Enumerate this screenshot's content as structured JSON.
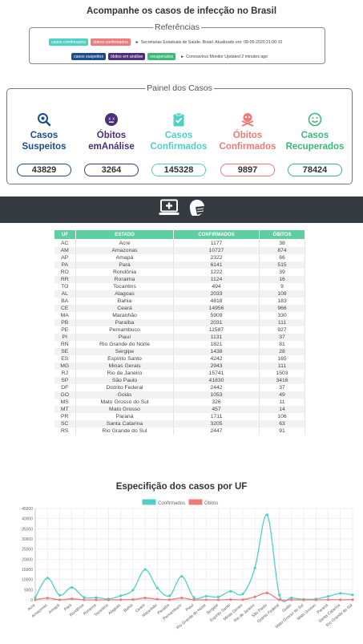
{
  "page": {
    "title": "Acompanhe os casos de infecção no Brasil"
  },
  "refs": {
    "legend": "Referências",
    "row1": {
      "tags": [
        "casos confirmados",
        "óbitos confirmados"
      ],
      "text": "Secretarias Estaduais de Saúde. Brasil. Atualizado em: 08-05-2020 21:00:10"
    },
    "row2": {
      "tags": [
        "casos suspeitos",
        "óbitos em análise",
        "recuperados"
      ],
      "text": "Coronavirus Monitor Updated 2 minutes ago"
    },
    "arrow": "►"
  },
  "panel": {
    "legend": "Painel dos Casos",
    "cards": [
      {
        "label1": "Casos",
        "label2": "Suspeitos",
        "value": "43829",
        "color": "#1a4c8a",
        "icon": "search-virus-icon"
      },
      {
        "label1": "Óbitos",
        "label2": "emAnálise",
        "value": "3264",
        "color": "#4a2f7c",
        "icon": "virus-face-icon"
      },
      {
        "label1": "Casos",
        "label2": "Confirmados",
        "value": "145328",
        "color": "#4fd1c5",
        "icon": "clipboard-check-icon"
      },
      {
        "label1": "Óbitos",
        "label2": "Confirmados",
        "value": "9897",
        "color": "#ef7a7a",
        "icon": "skull-crossbones-icon"
      },
      {
        "label1": "Casos",
        "label2": "Recuperados",
        "value": "78424",
        "color": "#3cb878",
        "icon": "smile-icon"
      }
    ]
  },
  "tag_colors": {
    "casos confirmados": "#4fd1c5",
    "óbitos confirmados": "#ef7a7a",
    "casos suspeitos": "#1a4c8a",
    "óbitos em análise": "#4a2f7c",
    "recuperados": "#3cb878"
  },
  "table": {
    "headers": [
      "UF",
      "ESTADO",
      "CONFIRMADOS",
      "ÓBITOS"
    ],
    "rows": [
      [
        "AC",
        "Acre",
        "1177",
        "38"
      ],
      [
        "AM",
        "Amazonas",
        "10727",
        "874"
      ],
      [
        "AP",
        "Amapá",
        "2322",
        "66"
      ],
      [
        "PA",
        "Pará",
        "6141",
        "515"
      ],
      [
        "RO",
        "Rondônia",
        "1222",
        "39"
      ],
      [
        "RR",
        "Roraima",
        "1124",
        "16"
      ],
      [
        "TO",
        "Tocantins",
        "494",
        "9"
      ],
      [
        "AL",
        "Alagoas",
        "2033",
        "108"
      ],
      [
        "BA",
        "Bahia",
        "4818",
        "183"
      ],
      [
        "CE",
        "Ceará",
        "14956",
        "966"
      ],
      [
        "MA",
        "Maranhão",
        "5909",
        "330"
      ],
      [
        "PB",
        "Paraíba",
        "2031",
        "111"
      ],
      [
        "PE",
        "Pernambuco",
        "11587",
        "927"
      ],
      [
        "PI",
        "Piauí",
        "1131",
        "37"
      ],
      [
        "RN",
        "Rio Grande do Norte",
        "1821",
        "81"
      ],
      [
        "SE",
        "Sergipe",
        "1438",
        "28"
      ],
      [
        "ES",
        "Espírito Santo",
        "4242",
        "165"
      ],
      [
        "MG",
        "Minas Gerais",
        "2943",
        "111"
      ],
      [
        "RJ",
        "Rio de Janeiro",
        "15741",
        "1503"
      ],
      [
        "SP",
        "São Paulo",
        "41830",
        "3416"
      ],
      [
        "DF",
        "Distrito Federal",
        "2442",
        "37"
      ],
      [
        "GO",
        "Goiás",
        "1053",
        "49"
      ],
      [
        "MS",
        "Mato Grosso do Sul",
        "326",
        "11"
      ],
      [
        "MT",
        "Mato Grosso",
        "457",
        "14"
      ],
      [
        "PR",
        "Paraná",
        "1711",
        "106"
      ],
      [
        "SC",
        "Santa Catarina",
        "3205",
        "63"
      ],
      [
        "RS",
        "Rio Grande do Sul",
        "2447",
        "91"
      ]
    ]
  },
  "chart_data": {
    "type": "line",
    "title": "Especifição dos casos por UF",
    "categories": [
      "Acre",
      "Amazonas",
      "Amapá",
      "Pará",
      "Rondônia",
      "Roraima",
      "Tocantins",
      "Alagoas",
      "Bahia",
      "Ceará",
      "Maranhão",
      "Paraíba",
      "Pernambuco",
      "Piauí",
      "Rio Grande do Norte",
      "Sergipe",
      "Espírito Santo",
      "Minas Gerais",
      "Rio de Janeiro",
      "São Paulo",
      "Distrito Federal",
      "Goiás",
      "Mato Grosso do Sul",
      "Mato Grosso",
      "Paraná",
      "Santa Catarina",
      "Rio Grande do Sul"
    ],
    "series": [
      {
        "name": "Confirmados",
        "color": "#4fd1c5",
        "values": [
          1177,
          10727,
          2322,
          6141,
          1222,
          1124,
          494,
          2033,
          4818,
          14956,
          5909,
          2031,
          11587,
          1131,
          1821,
          1438,
          4242,
          2943,
          15741,
          41830,
          2442,
          1053,
          326,
          457,
          1711,
          3205,
          2447
        ]
      },
      {
        "name": "Óbitos",
        "color": "#ef7a7a",
        "values": [
          38,
          874,
          66,
          515,
          39,
          16,
          9,
          108,
          183,
          966,
          330,
          111,
          927,
          37,
          81,
          28,
          165,
          111,
          1503,
          3416,
          37,
          49,
          11,
          14,
          106,
          63,
          91
        ]
      }
    ],
    "yticks": [
      "0",
      "5000",
      "10000",
      "15000",
      "20000",
      "25000",
      "30000",
      "35000",
      "40000",
      "45000"
    ],
    "ylim": [
      0,
      45000
    ],
    "legend_position": "top",
    "grid": true
  }
}
